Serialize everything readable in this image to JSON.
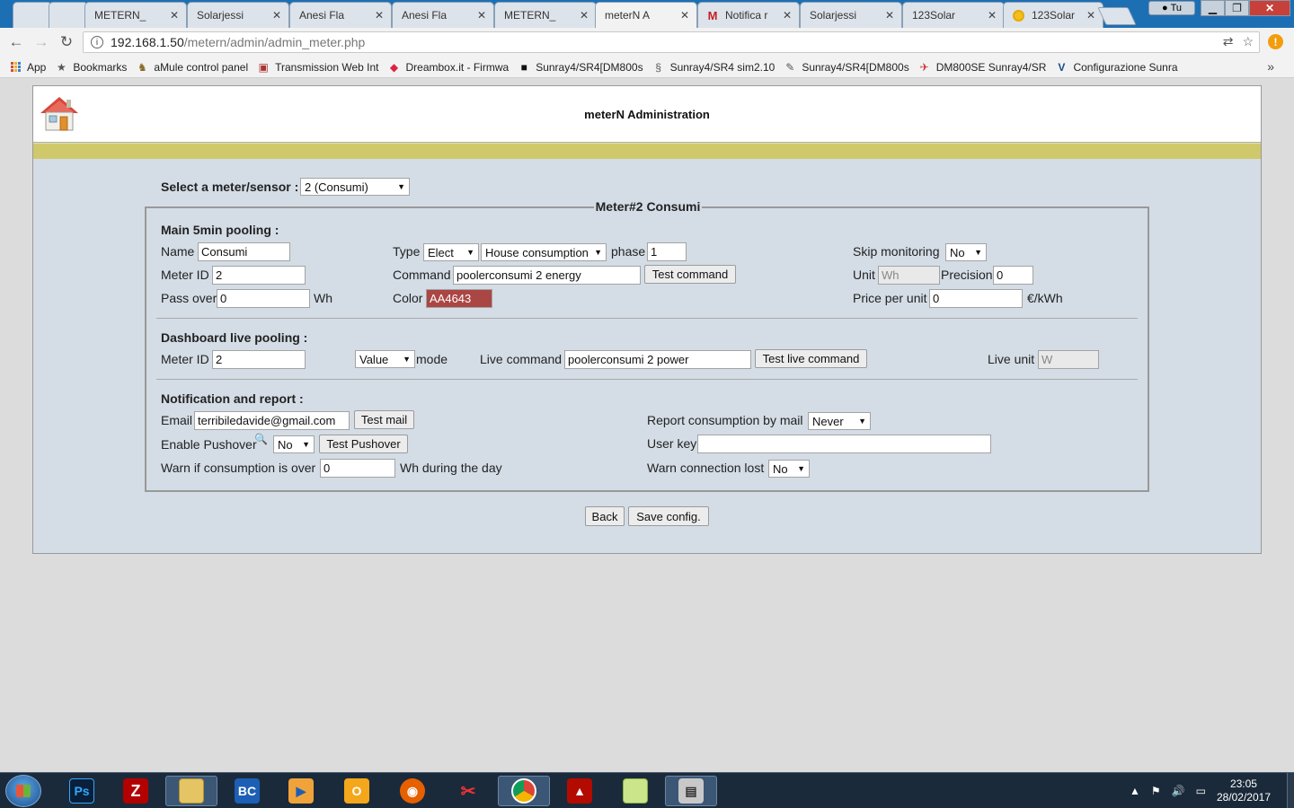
{
  "browser": {
    "tabs": [
      {
        "title": "",
        "icon": "page-icon"
      },
      {
        "title": "",
        "icon": "page-icon"
      },
      {
        "title": "METERN_",
        "icon": "page-icon"
      },
      {
        "title": "Solarjessi",
        "icon": "page-icon"
      },
      {
        "title": "Anesi Fla",
        "icon": "page-icon"
      },
      {
        "title": "Anesi Fla",
        "icon": "page-icon"
      },
      {
        "title": "METERN_",
        "icon": "page-icon"
      },
      {
        "title": "meterN A",
        "icon": "page-icon",
        "active": true
      },
      {
        "title": "Notifica r",
        "icon": "gmail-icon"
      },
      {
        "title": "Solarjessi",
        "icon": "page-icon"
      },
      {
        "title": "123Solar",
        "icon": "page-icon"
      },
      {
        "title": "123Solar",
        "icon": "sun-icon"
      }
    ],
    "profile_label": "Tu",
    "url_host": "192.168.1.50",
    "url_path": "/metern/admin/admin_meter.php",
    "bookmarks": [
      {
        "label": "App",
        "icon": "apps-icon"
      },
      {
        "label": "Bookmarks",
        "icon": "star-icon"
      },
      {
        "label": "aMule control panel",
        "icon": "amule-icon"
      },
      {
        "label": "Transmission Web Int",
        "icon": "transmission-icon"
      },
      {
        "label": "Dreambox.it - Firmwa",
        "icon": "dreambox-icon"
      },
      {
        "label": "Sunray4/SR4[DM800s",
        "icon": "sunray-icon"
      },
      {
        "label": "Sunray4/SR4 sim2.10",
        "icon": "sunray-icon"
      },
      {
        "label": "Sunray4/SR4[DM800s",
        "icon": "sunray-icon"
      },
      {
        "label": "DM800SE Sunray4/SR",
        "icon": "dm800-icon"
      },
      {
        "label": "Configurazione Sunra",
        "icon": "config-icon"
      }
    ]
  },
  "app": {
    "title": "meterN Administration",
    "select_label": "Select a meter/sensor :",
    "select_value": "2 (Consumi)",
    "legend": "Meter#2 Consumi"
  },
  "main": {
    "section_title": "Main 5min pooling :",
    "name_label": "Name",
    "name_value": "Consumi",
    "meterid_label": "Meter ID",
    "meterid_value": "2",
    "passover_label": "Pass over",
    "passover_value": "0",
    "passover_unit": "Wh",
    "type_label": "Type",
    "type_value": "Elect",
    "type2_value": "House consumption",
    "phase_label": "phase",
    "phase_value": "1",
    "command_label": "Command",
    "command_value": "poolerconsumi 2 energy",
    "test_command": "Test command",
    "color_label": "Color",
    "color_value": "AA4643",
    "skip_label": "Skip monitoring",
    "skip_value": "No",
    "unit_label": "Unit",
    "unit_value": "Wh",
    "precision_label": "Precision",
    "precision_value": "0",
    "price_label": "Price per unit",
    "price_value": "0",
    "price_unit": "€/kWh"
  },
  "live": {
    "section_title": "Dashboard live pooling :",
    "meterid_label": "Meter ID",
    "meterid_value": "2",
    "mode_value": "Value",
    "mode_label": "mode",
    "command_label": "Live command",
    "command_value": "poolerconsumi 2 power",
    "test_button": "Test live command",
    "unit_label": "Live unit",
    "unit_value": "W"
  },
  "notify": {
    "section_title": "Notification and report :",
    "email_label": "Email",
    "email_value": "terribiledavide@gmail.com",
    "test_mail": "Test mail",
    "pushover_label": "Enable Pushover",
    "pushover_value": "No",
    "test_pushover": "Test Pushover",
    "warn_label": "Warn if consumption is over",
    "warn_value": "0",
    "warn_suffix": "Wh during the day",
    "report_label": "Report consumption by mail",
    "report_value": "Never",
    "userkey_label": "User key",
    "userkey_value": "",
    "lost_label": "Warn connection lost",
    "lost_value": "No"
  },
  "actions": {
    "back": "Back",
    "save": "Save config."
  },
  "taskbar": {
    "time": "23:05",
    "date": "28/02/2017",
    "apps": [
      "photoshop",
      "filezilla",
      "file-explorer",
      "beyond-compare",
      "media-player",
      "outlook",
      "firefox",
      "snipping-tool",
      "chrome",
      "acrobat",
      "folder",
      "control-panel"
    ]
  }
}
